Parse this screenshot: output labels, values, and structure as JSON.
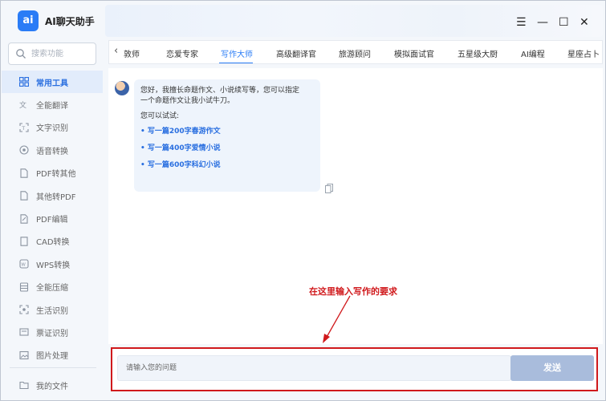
{
  "app": {
    "logo_text": "ai",
    "title": "AI聊天助手"
  },
  "search": {
    "placeholder": "搜索功能"
  },
  "sidebar": {
    "items": [
      {
        "label": "常用工具",
        "icon": "grid-icon",
        "active": true
      },
      {
        "label": "全能翻译",
        "icon": "translate-icon"
      },
      {
        "label": "文字识别",
        "icon": "text-scan-icon"
      },
      {
        "label": "语音转换",
        "icon": "voice-icon"
      },
      {
        "label": "PDF转其他",
        "icon": "pdf-icon"
      },
      {
        "label": "其他转PDF",
        "icon": "pdf-icon"
      },
      {
        "label": "PDF编辑",
        "icon": "pdf-edit-icon"
      },
      {
        "label": "CAD转换",
        "icon": "cad-icon"
      },
      {
        "label": "WPS转换",
        "icon": "wps-icon"
      },
      {
        "label": "全能压缩",
        "icon": "compress-icon"
      },
      {
        "label": "生活识别",
        "icon": "scan-icon"
      },
      {
        "label": "票证识别",
        "icon": "ticket-icon"
      },
      {
        "label": "图片处理",
        "icon": "image-icon"
      }
    ],
    "my_files": "我的文件"
  },
  "window_controls": {
    "menu": "☰",
    "minimize": "—",
    "maximize": "☐",
    "close": "✕"
  },
  "tabs": {
    "items": [
      "敦师",
      "恋爱专家",
      "写作大师",
      "高级翻译官",
      "旅游顾问",
      "模拟面试官",
      "五星级大厨",
      "AI编程",
      "星座占卜"
    ],
    "active_index": 2
  },
  "chat": {
    "greeting_line1": "您好，我擅长命题作文、小说续写等，您可以指定",
    "greeting_line2": "一个命题作文让我小试牛刀。",
    "try_label": "您可以试试:",
    "suggestions": [
      "写一篇200字春游作文",
      "写一篇400字爱情小说",
      "写一篇600字科幻小说"
    ]
  },
  "annotation": {
    "text": "在这里输入写作的要求",
    "color": "#d0191c"
  },
  "input": {
    "placeholder": "请输入您的问题",
    "send_label": "发送"
  },
  "colors": {
    "accent": "#2a7cf6",
    "annotation": "#d0191c",
    "send_button": "#a9bcdc"
  }
}
